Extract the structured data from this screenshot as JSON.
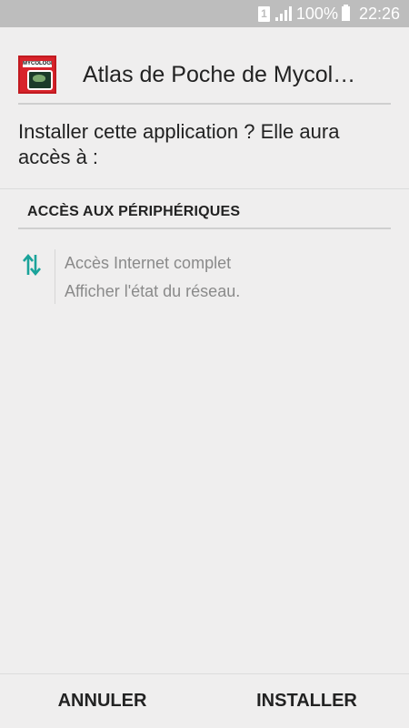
{
  "status_bar": {
    "sim_slot": "1",
    "battery_percent": "100%",
    "time": "22:26"
  },
  "header": {
    "app_name": "Atlas de Poche de Mycol…",
    "app_icon_caption": "MYCOLOGIE"
  },
  "prompt": {
    "question": "Installer cette application ? Elle aura accès à :"
  },
  "section": {
    "title": "ACCÈS AUX PÉRIPHÉRIQUES",
    "icon": "network-transfer-icon",
    "permissions": [
      "Accès Internet complet",
      "Afficher l'état du réseau."
    ]
  },
  "buttons": {
    "cancel": "ANNULER",
    "install": "INSTALLER"
  },
  "colors": {
    "status_bar_bg": "#bdbdbd",
    "background": "#efeeee",
    "accent_icon": "#1aa39a",
    "app_icon_red": "#d8232a"
  }
}
